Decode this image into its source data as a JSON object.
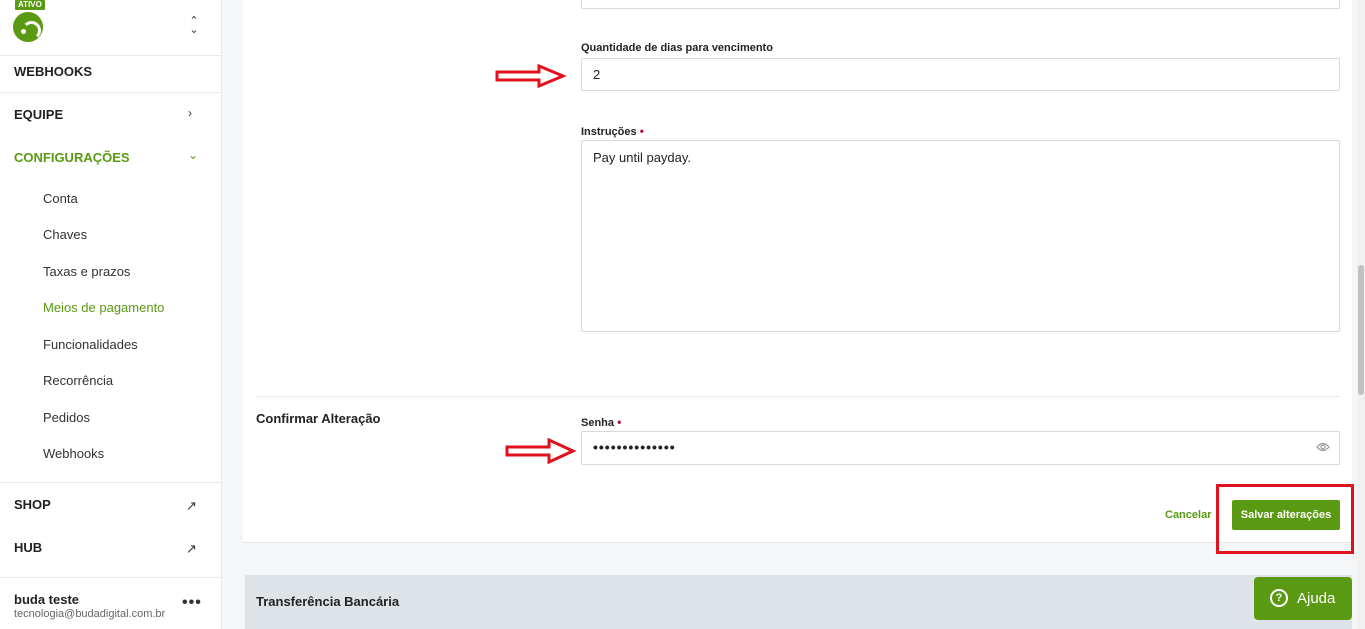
{
  "sidebar": {
    "badge": "ATIVO",
    "logo_icon": "buda-logo-icon",
    "switch_icon": "⌃⌄",
    "items": [
      {
        "label": "WEBHOOKS"
      },
      {
        "label": "EQUIPE",
        "chevron": "›"
      },
      {
        "label": "CONFIGURAÇÕES",
        "chevron": "⌄"
      }
    ],
    "sub_items": [
      {
        "label": "Conta"
      },
      {
        "label": "Chaves"
      },
      {
        "label": "Taxas e prazos"
      },
      {
        "label": "Meios de pagamento"
      },
      {
        "label": "Funcionalidades"
      },
      {
        "label": "Recorrência"
      },
      {
        "label": "Pedidos"
      },
      {
        "label": "Webhooks"
      }
    ],
    "external": [
      {
        "label": "SHOP",
        "icon": "↗"
      },
      {
        "label": "HUB",
        "icon": "↗"
      }
    ],
    "user": {
      "name": "buda teste",
      "email": "tecnologia@budadigital.com.br",
      "more": "•••"
    }
  },
  "form": {
    "days_label": "Quantidade de dias para vencimento",
    "days_value": "2",
    "instructions_label": "Instruções",
    "instructions_value": "Pay until payday.",
    "required_mark": "•",
    "confirm_section": "Confirmar Alteração",
    "password_label": "Senha",
    "password_value": "••••••••••••••",
    "cancel_label": "Cancelar",
    "save_label": "Salvar alterações"
  },
  "transfer": {
    "title": "Transferência Bancária"
  },
  "help": {
    "icon": "?",
    "label": "Ajuda"
  },
  "colors": {
    "brand": "#5a9a12",
    "required": "#b0153f",
    "annotation": "#e0121d"
  }
}
